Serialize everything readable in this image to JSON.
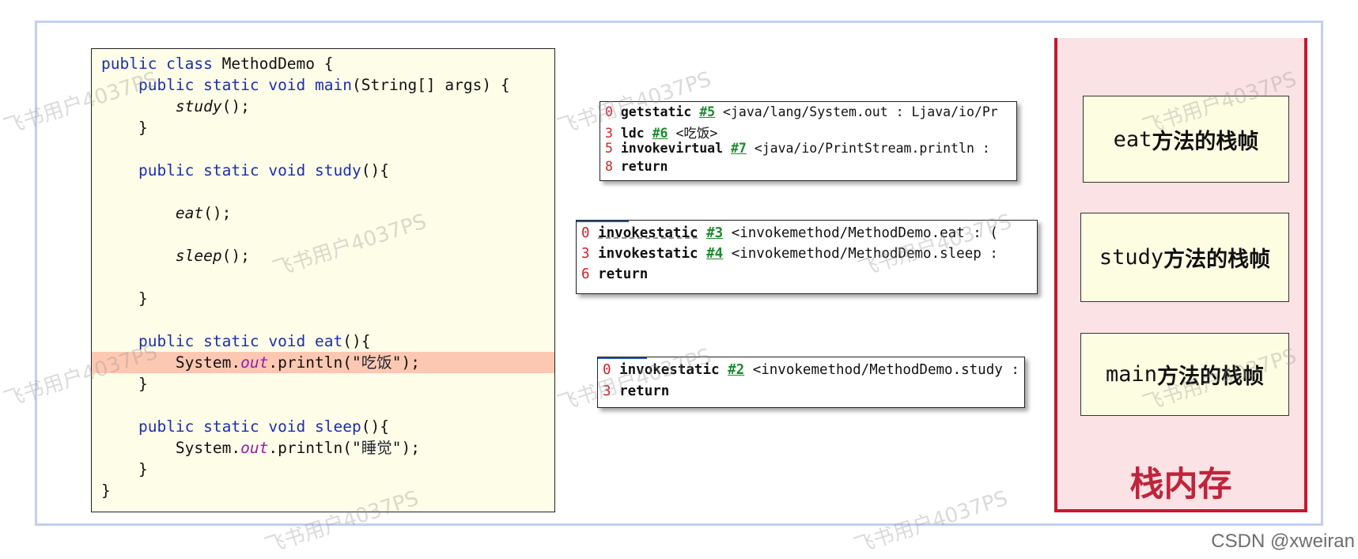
{
  "code": {
    "lines": [
      {
        "indent": "",
        "parts": [
          {
            "t": "public class",
            "c": "kw"
          },
          {
            "t": " MethodDemo {",
            "c": ""
          }
        ]
      },
      {
        "indent": "    ",
        "parts": [
          {
            "t": "public static void",
            "c": "kw"
          },
          {
            "t": " ",
            "c": ""
          },
          {
            "t": "main",
            "c": "kw"
          },
          {
            "t": "(String[] args) {",
            "c": ""
          }
        ]
      },
      {
        "indent": "        ",
        "parts": [
          {
            "t": "study",
            "c": "it"
          },
          {
            "t": "();",
            "c": ""
          }
        ]
      },
      {
        "indent": "    ",
        "parts": [
          {
            "t": "}",
            "c": ""
          }
        ]
      },
      {
        "indent": "",
        "parts": []
      },
      {
        "indent": "    ",
        "parts": [
          {
            "t": "public static void",
            "c": "kw"
          },
          {
            "t": " ",
            "c": ""
          },
          {
            "t": "study",
            "c": "kw"
          },
          {
            "t": "(){",
            "c": ""
          }
        ]
      },
      {
        "indent": "",
        "parts": []
      },
      {
        "indent": "        ",
        "parts": [
          {
            "t": "eat",
            "c": "it"
          },
          {
            "t": "();",
            "c": ""
          }
        ]
      },
      {
        "indent": "",
        "parts": []
      },
      {
        "indent": "        ",
        "parts": [
          {
            "t": "sleep",
            "c": "it"
          },
          {
            "t": "();",
            "c": ""
          }
        ]
      },
      {
        "indent": "",
        "parts": []
      },
      {
        "indent": "    ",
        "parts": [
          {
            "t": "}",
            "c": ""
          }
        ]
      },
      {
        "indent": "",
        "parts": []
      },
      {
        "indent": "    ",
        "parts": [
          {
            "t": "public static void",
            "c": "kw"
          },
          {
            "t": " ",
            "c": ""
          },
          {
            "t": "eat",
            "c": "kw"
          },
          {
            "t": "(){",
            "c": ""
          }
        ]
      },
      {
        "indent": "        ",
        "highlight": true,
        "parts": [
          {
            "t": "System.",
            "c": ""
          },
          {
            "t": "out",
            "c": "fld"
          },
          {
            "t": ".println(\"",
            "c": ""
          },
          {
            "t": "吃饭",
            "c": "str"
          },
          {
            "t": "\");",
            "c": ""
          }
        ]
      },
      {
        "indent": "    ",
        "parts": [
          {
            "t": "}",
            "c": ""
          }
        ]
      },
      {
        "indent": "",
        "parts": []
      },
      {
        "indent": "    ",
        "parts": [
          {
            "t": "public static void",
            "c": "kw"
          },
          {
            "t": " ",
            "c": ""
          },
          {
            "t": "sleep",
            "c": "kw"
          },
          {
            "t": "(){",
            "c": ""
          }
        ]
      },
      {
        "indent": "        ",
        "parts": [
          {
            "t": "System.",
            "c": ""
          },
          {
            "t": "out",
            "c": "fld"
          },
          {
            "t": ".println(\"",
            "c": ""
          },
          {
            "t": "睡觉",
            "c": "str"
          },
          {
            "t": "\");",
            "c": ""
          }
        ]
      },
      {
        "indent": "    ",
        "parts": [
          {
            "t": "}",
            "c": ""
          }
        ]
      },
      {
        "indent": "",
        "parts": [
          {
            "t": "}",
            "c": ""
          }
        ]
      }
    ]
  },
  "bytecode": {
    "eat": [
      {
        "num": "0",
        "op": "getstatic",
        "ref": "#5",
        "arg": "<java/lang/System.out : Ljava/io/Pr"
      },
      {
        "num": "3",
        "op": "ldc",
        "ref": "#6",
        "arg": "<吃饭>"
      },
      {
        "num": "5",
        "op": "invokevirtual",
        "ref": "#7",
        "arg": "<java/io/PrintStream.println :"
      },
      {
        "num": "8",
        "op": "return",
        "ref": "",
        "arg": ""
      }
    ],
    "study": [
      {
        "num": "0",
        "op": "invokestatic",
        "ref": "#3",
        "arg": "<invokemethod/MethodDemo.eat : ("
      },
      {
        "num": "3",
        "op": "invokestatic",
        "ref": "#4",
        "arg": "<invokemethod/MethodDemo.sleep :"
      },
      {
        "num": "6",
        "op": "return",
        "ref": "",
        "arg": ""
      }
    ],
    "main": [
      {
        "num": "0",
        "op": "invokestatic",
        "ref": "#2",
        "arg": "<invokemethod/MethodDemo.study :"
      },
      {
        "num": "3",
        "op": "return",
        "ref": "",
        "arg": ""
      }
    ]
  },
  "stack": {
    "title": "栈内存",
    "frames": [
      {
        "name": "eat",
        "suffix": "方法的栈帧"
      },
      {
        "name": "study",
        "suffix": "方法的栈帧"
      },
      {
        "name": "main",
        "suffix": "方法的栈帧"
      }
    ]
  },
  "watermark": "飞书用户4037PS",
  "credit": "CSDN @xweiran",
  "colors": {
    "keyword": "#1c2fae",
    "field": "#9b1aa6",
    "highlight": "#fdc8b2",
    "bytecode_number": "#d0232a",
    "bytecode_ref": "#1a8a2e",
    "stack_border": "#c5182c",
    "stack_title": "#c0243a"
  }
}
